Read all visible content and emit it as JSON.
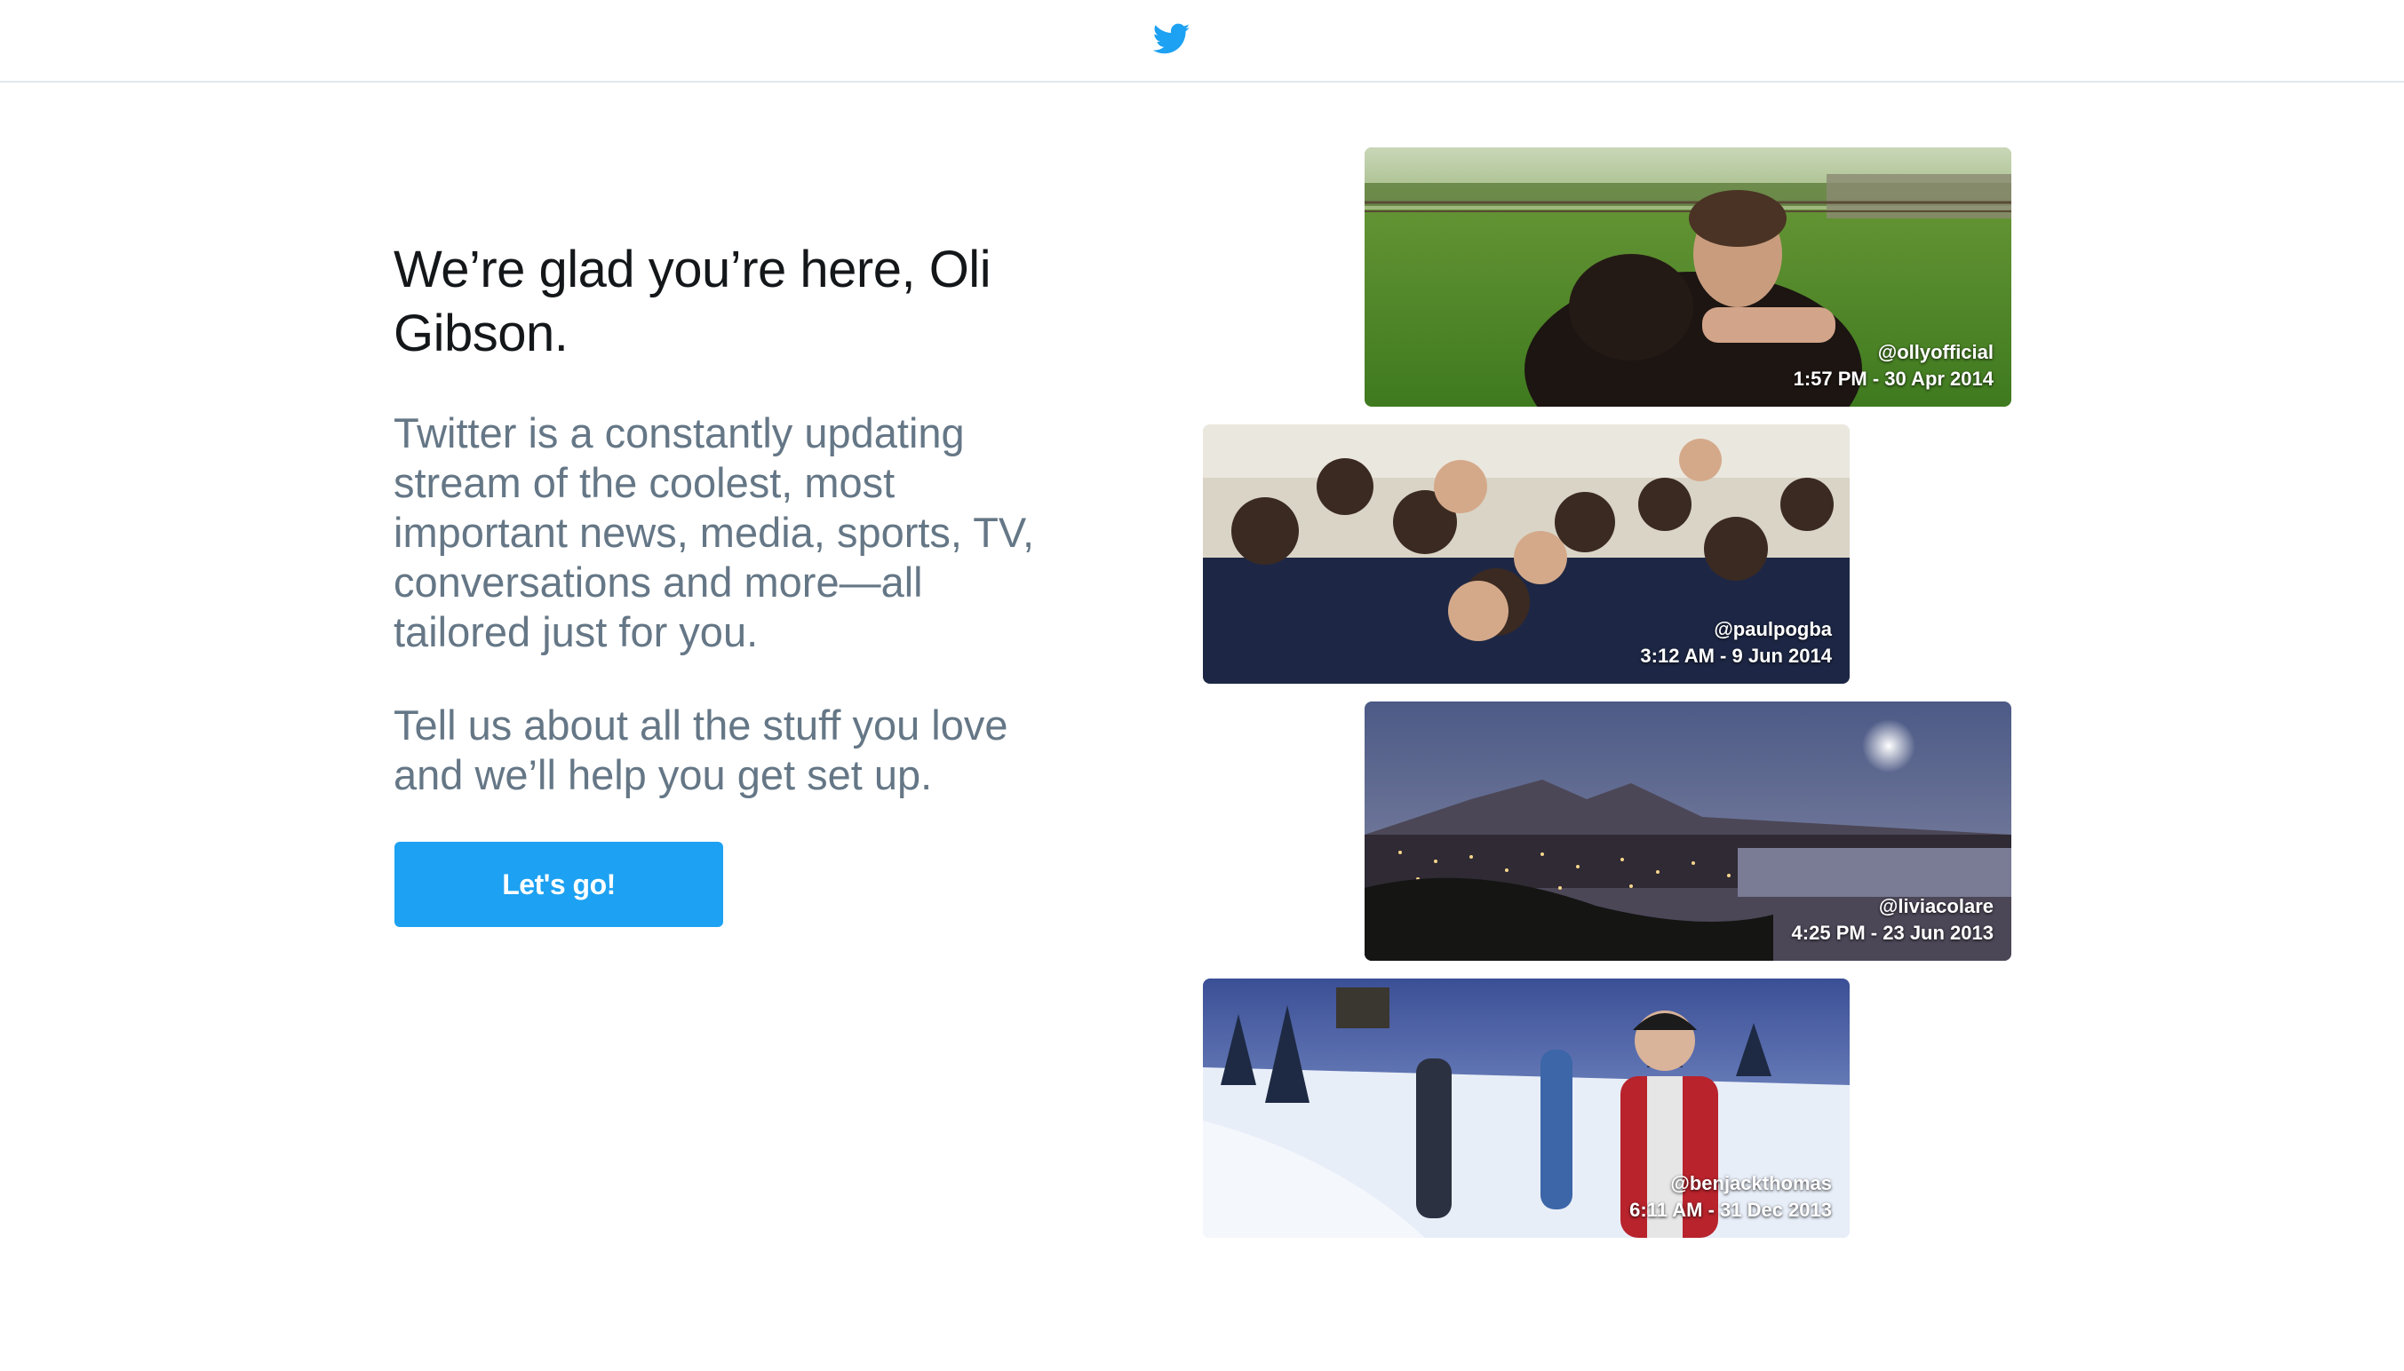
{
  "header": {
    "logo_icon": "twitter-bird-icon",
    "brand_color": "#1da1f2"
  },
  "welcome": {
    "headline": "We’re glad you’re here, Oli Gibson.",
    "paragraph_1": "Twitter is a constantly updating stream of the coolest, most important news, media, sports, TV, conversations and more—all tailored just for you.",
    "paragraph_2": "Tell us about all the stuff you love and we’ll help you get set up.",
    "cta_label": "Let's go!"
  },
  "photos": [
    {
      "handle": "@ollyofficial",
      "timestamp": "1:57 PM - 30 Apr 2014"
    },
    {
      "handle": "@paulpogba",
      "timestamp": "3:12 AM - 9 Jun 2014"
    },
    {
      "handle": "@liviacolare",
      "timestamp": "4:25 PM - 23 Jun 2013"
    },
    {
      "handle": "@benjackthomas",
      "timestamp": "6:11 AM - 31 Dec 2013"
    }
  ]
}
